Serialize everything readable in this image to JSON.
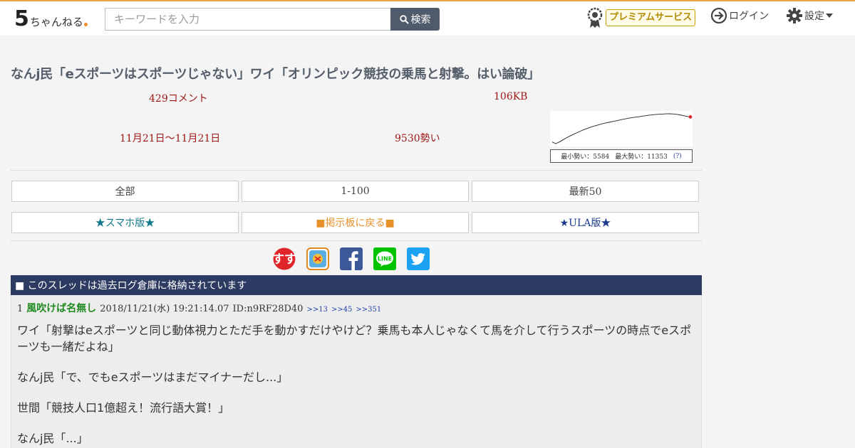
{
  "header": {
    "logo_numeral": "5",
    "logo_text": "ちゃんねる",
    "search_placeholder": "キーワードを入力",
    "search_button": "検索",
    "premium_label": "プレミアムサービス",
    "login_label": "ログイン",
    "settings_label": "設定"
  },
  "thread": {
    "title": "なんj民「eスポーツはスポーツじゃない」ワイ「オリンピック競技の乗馬と射撃。はい論破」",
    "comments": "429コメント",
    "size": "106KB",
    "date_range": "11月21日〜11月21日",
    "momentum": "9530勢い"
  },
  "chart_data": {
    "type": "line",
    "title": "",
    "caption_min": "最小勢い：5584",
    "caption_max": "最大勢い：11353",
    "caption_help": "(?)",
    "ylim": [
      5584,
      11353
    ],
    "values": [
      5900,
      5584,
      5900,
      6300,
      6700,
      7050,
      7400,
      7700,
      8000,
      8300,
      8550,
      8800,
      9000,
      9200,
      9400,
      9550,
      9700,
      9850,
      10000,
      10150,
      10300,
      10420,
      10550,
      10650,
      10750,
      10850,
      10950,
      11050,
      11120,
      11200,
      11260,
      11300,
      11340,
      11353,
      11320,
      11250,
      11150,
      11000,
      10850,
      10750
    ]
  },
  "nav": {
    "all": "全部",
    "range": "1-100",
    "latest": "最新50",
    "smartphone": "★スマホ版★",
    "back": "■掲示板に戻る■",
    "ula": "★ULA版★"
  },
  "share": {
    "items": [
      "sumasu",
      "matome",
      "facebook",
      "line",
      "twitter"
    ]
  },
  "archive_notice": "■ このスレッドは過去ログ倉庫に格納されています",
  "post": {
    "number": "1",
    "name": "風吹けば名無し",
    "datetime": "2018/11/21(水) 19:21:14.07",
    "id": "ID:n9RF28D40",
    "replies": [
      ">>13",
      ">>45",
      ">>351"
    ],
    "body": [
      "ワイ「射撃はeスポーツと同じ動体視力とただ手を動かすだけやけど？乗馬も本人じゃなくて馬を介して行うスポーツの時点でeスポーツも一緒だよね」",
      "なんj民「で、でもeスポーツはまだマイナーだし...」",
      "世間「競技人口1億超え！流行語大賞！」",
      "なんj民「...」"
    ]
  },
  "colors": {
    "accent_line": "#e8a24a",
    "search_button": "#4f5a6b",
    "meta_red": "#a01818",
    "archive_bar": "#2d3b63",
    "poster_green": "#1f8a1f"
  }
}
